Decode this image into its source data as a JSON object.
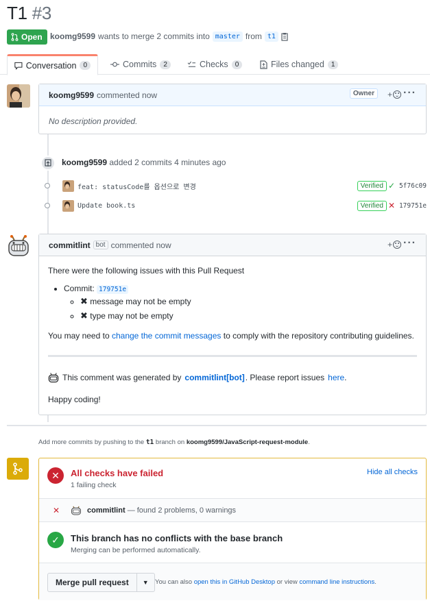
{
  "header": {
    "title": "T1",
    "number": "#3",
    "state": "Open",
    "author": "koomg9599",
    "merge_text": "wants to merge 2 commits into",
    "base_branch": "master",
    "from_text": "from",
    "head_branch": "t1"
  },
  "tabs": [
    {
      "label": "Conversation",
      "count": "0"
    },
    {
      "label": "Commits",
      "count": "2"
    },
    {
      "label": "Checks",
      "count": "0"
    },
    {
      "label": "Files changed",
      "count": "1"
    }
  ],
  "first_comment": {
    "author": "koomg9599",
    "action": "commented now",
    "badge": "Owner",
    "body": "No description provided."
  },
  "commits_event": {
    "author": "koomg9599",
    "text": "added 2 commits 4 minutes ago",
    "commits": [
      {
        "message": "feat: statusCode를 옵션으로 변경",
        "verified": "Verified",
        "status": "✓",
        "status_color": "#28a745",
        "sha": "5f76c09"
      },
      {
        "message": "Update book.ts",
        "verified": "Verified",
        "status": "✕",
        "status_color": "#cb2431",
        "sha": "179751e"
      }
    ]
  },
  "bot_comment": {
    "author": "commitlint",
    "bot_label": "bot",
    "action": "commented now",
    "intro": "There were the following issues with this Pull Request",
    "commit_label": "Commit:",
    "commit_sha": "179751e",
    "issues": [
      "message may not be empty",
      "type may not be empty"
    ],
    "advice_prefix": "You may need to",
    "advice_link": "change the commit messages",
    "advice_suffix": "to comply with the repository contributing guidelines.",
    "generated_prefix": "This comment was generated by",
    "generated_link": "commitlint[bot]",
    "generated_mid": ". Please report issues",
    "generated_here": "here",
    "generated_end": ".",
    "signoff": "Happy coding!"
  },
  "push_hint": {
    "prefix": "Add more commits by pushing to the",
    "branch": "t1",
    "mid": "branch on",
    "repo": "koomg9599/JavaScript-request-module",
    "end": "."
  },
  "checks": {
    "title": "All checks have failed",
    "subtitle": "1 failing check",
    "hide_link": "Hide all checks",
    "check_name": "commitlint",
    "check_result": "— found 2 problems, 0 warnings"
  },
  "conflicts": {
    "title": "This branch has no conflicts with the base branch",
    "subtitle": "Merging can be performed automatically."
  },
  "merge": {
    "button": "Merge pull request",
    "also_prefix": "You can also",
    "desktop_link": "open this in GitHub Desktop",
    "or_text": "or view",
    "cli_link": "command line instructions",
    "end": "."
  },
  "colors": {
    "open_green": "#2ea44f",
    "fail_red": "#cb2431",
    "success_green": "#28a745",
    "merge_border": "#e2b93d",
    "link_blue": "#0366d6"
  }
}
